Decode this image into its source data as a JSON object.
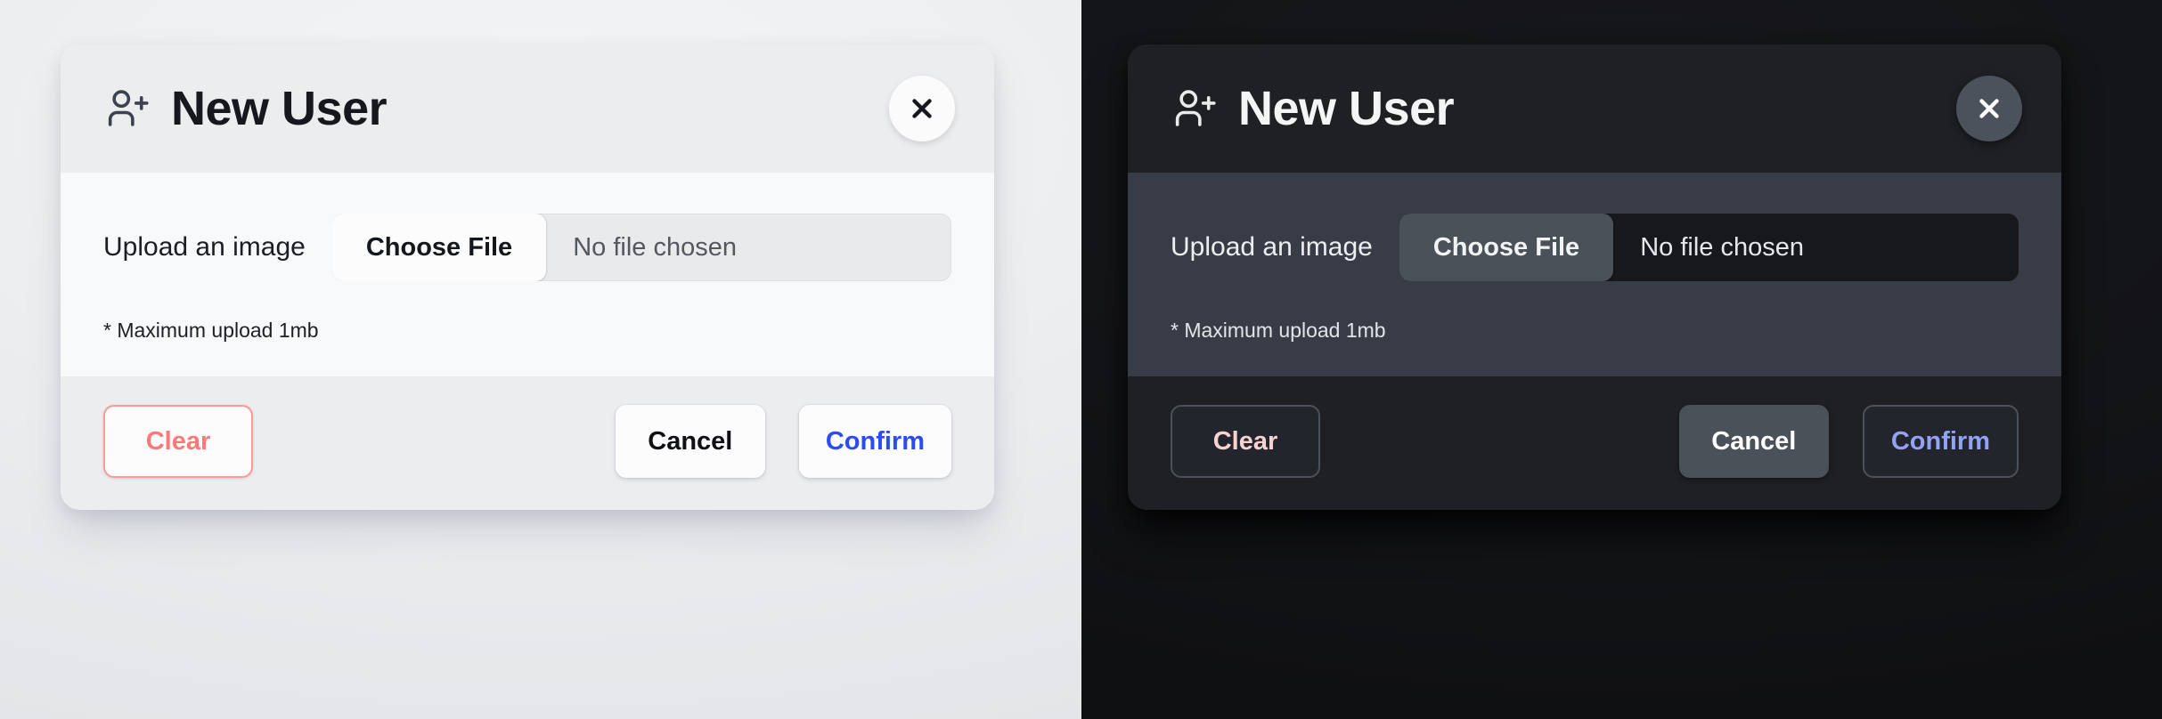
{
  "themes": [
    {
      "name": "light",
      "header": {
        "icon": "user-plus-icon",
        "title": "New User",
        "close_label": "×",
        "close_icon": "close-icon"
      },
      "body": {
        "field_label": "Upload an image",
        "choose_file_label": "Choose File",
        "file_name": "No file chosen",
        "hint": "* Maximum upload 1mb"
      },
      "footer": {
        "clear_label": "Clear",
        "cancel_label": "Cancel",
        "confirm_label": "Confirm"
      }
    },
    {
      "name": "dark",
      "header": {
        "icon": "user-plus-icon",
        "title": "New User",
        "close_label": "×",
        "close_icon": "close-icon"
      },
      "body": {
        "field_label": "Upload an image",
        "choose_file_label": "Choose File",
        "file_name": "No file chosen",
        "hint": "* Maximum upload 1mb"
      },
      "footer": {
        "clear_label": "Clear",
        "cancel_label": "Cancel",
        "confirm_label": "Confirm"
      }
    }
  ],
  "colors": {
    "light_page_bg": "#e9ebee",
    "light_card_bg": "#f8f9fa",
    "light_header_bg": "#ecedef",
    "light_title_text": "#16181d",
    "light_clear_border": "#f99a96",
    "light_clear_text": "#fa7a7a",
    "light_confirm_text": "#2b4cf5",
    "dark_page_bg": "#131417",
    "dark_card_bg": "#383c46",
    "dark_header_bg": "#1e2024",
    "dark_title_text": "#f4f5f7",
    "dark_clear_text": "#f6d2d2",
    "dark_confirm_text": "#93a2f7",
    "dark_cancel_bg": "#4b5159",
    "dark_file_field_bg": "#16181b"
  }
}
